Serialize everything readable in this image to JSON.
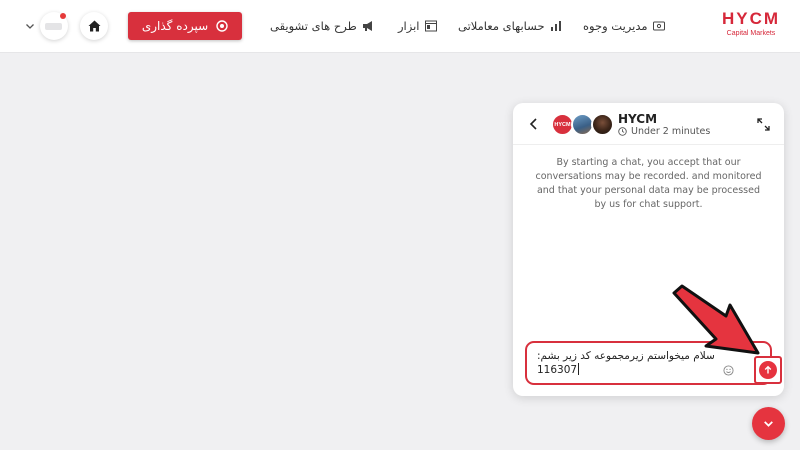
{
  "brand": {
    "name": "HYCM",
    "tagline": "Capital Markets",
    "color": "#d6283a"
  },
  "nav": {
    "items": [
      {
        "label": "مدیریت وجوه",
        "icon": "wallet-icon"
      },
      {
        "label": "حسابهای معاملاتی",
        "icon": "bar-chart-icon"
      },
      {
        "label": "ابزار",
        "icon": "tools-window-icon"
      },
      {
        "label": "طرح های تشویقی",
        "icon": "megaphone-icon"
      }
    ],
    "deposit_label": "سپرده گذاری",
    "home_icon": "home-icon",
    "profile_icon": "user-avatar-icon",
    "dropdown_icon": "chevron-down-icon"
  },
  "chat": {
    "agent_name": "HYCM",
    "status": "Under 2 minutes",
    "avatar_label": "HYCM",
    "disclaimer": "By starting a chat, you accept that our conversations may be recorded. and monitored and that your personal data may be processed by us for chat support.",
    "message_line1": "سلام میخواستم زیرمجموعه کد زیر بشم:",
    "message_line2": "116307",
    "send_icon": "arrow-up-icon",
    "emoji_icon": "smiley-icon",
    "expand_icon": "expand-icon",
    "back_icon": "chevron-left-icon"
  },
  "fab_icon": "chevron-down-icon",
  "colors": {
    "accent": "#d8303d",
    "background": "#f0f0f2"
  }
}
